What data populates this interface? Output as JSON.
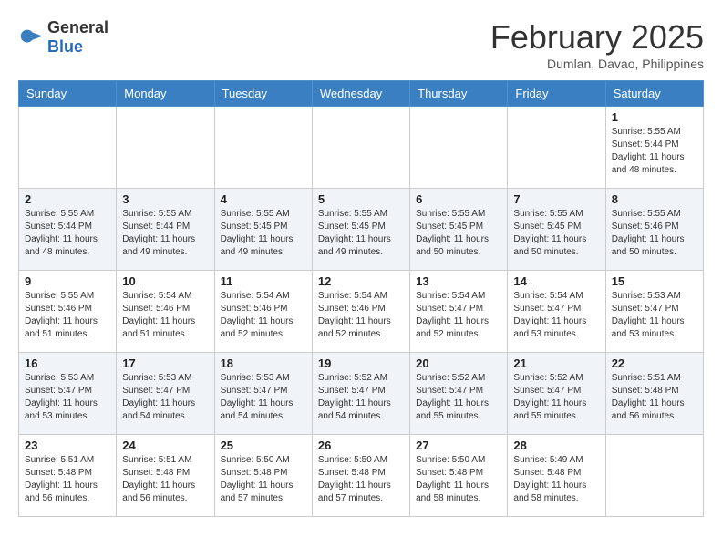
{
  "logo": {
    "general": "General",
    "blue": "Blue"
  },
  "title": {
    "month_year": "February 2025",
    "location": "Dumlan, Davao, Philippines"
  },
  "weekdays": [
    "Sunday",
    "Monday",
    "Tuesday",
    "Wednesday",
    "Thursday",
    "Friday",
    "Saturday"
  ],
  "weeks": [
    [
      {
        "day": "",
        "info": ""
      },
      {
        "day": "",
        "info": ""
      },
      {
        "day": "",
        "info": ""
      },
      {
        "day": "",
        "info": ""
      },
      {
        "day": "",
        "info": ""
      },
      {
        "day": "",
        "info": ""
      },
      {
        "day": "1",
        "info": "Sunrise: 5:55 AM\nSunset: 5:44 PM\nDaylight: 11 hours\nand 48 minutes."
      }
    ],
    [
      {
        "day": "2",
        "info": "Sunrise: 5:55 AM\nSunset: 5:44 PM\nDaylight: 11 hours\nand 48 minutes."
      },
      {
        "day": "3",
        "info": "Sunrise: 5:55 AM\nSunset: 5:44 PM\nDaylight: 11 hours\nand 49 minutes."
      },
      {
        "day": "4",
        "info": "Sunrise: 5:55 AM\nSunset: 5:45 PM\nDaylight: 11 hours\nand 49 minutes."
      },
      {
        "day": "5",
        "info": "Sunrise: 5:55 AM\nSunset: 5:45 PM\nDaylight: 11 hours\nand 49 minutes."
      },
      {
        "day": "6",
        "info": "Sunrise: 5:55 AM\nSunset: 5:45 PM\nDaylight: 11 hours\nand 50 minutes."
      },
      {
        "day": "7",
        "info": "Sunrise: 5:55 AM\nSunset: 5:45 PM\nDaylight: 11 hours\nand 50 minutes."
      },
      {
        "day": "8",
        "info": "Sunrise: 5:55 AM\nSunset: 5:46 PM\nDaylight: 11 hours\nand 50 minutes."
      }
    ],
    [
      {
        "day": "9",
        "info": "Sunrise: 5:55 AM\nSunset: 5:46 PM\nDaylight: 11 hours\nand 51 minutes."
      },
      {
        "day": "10",
        "info": "Sunrise: 5:54 AM\nSunset: 5:46 PM\nDaylight: 11 hours\nand 51 minutes."
      },
      {
        "day": "11",
        "info": "Sunrise: 5:54 AM\nSunset: 5:46 PM\nDaylight: 11 hours\nand 52 minutes."
      },
      {
        "day": "12",
        "info": "Sunrise: 5:54 AM\nSunset: 5:46 PM\nDaylight: 11 hours\nand 52 minutes."
      },
      {
        "day": "13",
        "info": "Sunrise: 5:54 AM\nSunset: 5:47 PM\nDaylight: 11 hours\nand 52 minutes."
      },
      {
        "day": "14",
        "info": "Sunrise: 5:54 AM\nSunset: 5:47 PM\nDaylight: 11 hours\nand 53 minutes."
      },
      {
        "day": "15",
        "info": "Sunrise: 5:53 AM\nSunset: 5:47 PM\nDaylight: 11 hours\nand 53 minutes."
      }
    ],
    [
      {
        "day": "16",
        "info": "Sunrise: 5:53 AM\nSunset: 5:47 PM\nDaylight: 11 hours\nand 53 minutes."
      },
      {
        "day": "17",
        "info": "Sunrise: 5:53 AM\nSunset: 5:47 PM\nDaylight: 11 hours\nand 54 minutes."
      },
      {
        "day": "18",
        "info": "Sunrise: 5:53 AM\nSunset: 5:47 PM\nDaylight: 11 hours\nand 54 minutes."
      },
      {
        "day": "19",
        "info": "Sunrise: 5:52 AM\nSunset: 5:47 PM\nDaylight: 11 hours\nand 54 minutes."
      },
      {
        "day": "20",
        "info": "Sunrise: 5:52 AM\nSunset: 5:47 PM\nDaylight: 11 hours\nand 55 minutes."
      },
      {
        "day": "21",
        "info": "Sunrise: 5:52 AM\nSunset: 5:47 PM\nDaylight: 11 hours\nand 55 minutes."
      },
      {
        "day": "22",
        "info": "Sunrise: 5:51 AM\nSunset: 5:48 PM\nDaylight: 11 hours\nand 56 minutes."
      }
    ],
    [
      {
        "day": "23",
        "info": "Sunrise: 5:51 AM\nSunset: 5:48 PM\nDaylight: 11 hours\nand 56 minutes."
      },
      {
        "day": "24",
        "info": "Sunrise: 5:51 AM\nSunset: 5:48 PM\nDaylight: 11 hours\nand 56 minutes."
      },
      {
        "day": "25",
        "info": "Sunrise: 5:50 AM\nSunset: 5:48 PM\nDaylight: 11 hours\nand 57 minutes."
      },
      {
        "day": "26",
        "info": "Sunrise: 5:50 AM\nSunset: 5:48 PM\nDaylight: 11 hours\nand 57 minutes."
      },
      {
        "day": "27",
        "info": "Sunrise: 5:50 AM\nSunset: 5:48 PM\nDaylight: 11 hours\nand 58 minutes."
      },
      {
        "day": "28",
        "info": "Sunrise: 5:49 AM\nSunset: 5:48 PM\nDaylight: 11 hours\nand 58 minutes."
      },
      {
        "day": "",
        "info": ""
      }
    ]
  ]
}
